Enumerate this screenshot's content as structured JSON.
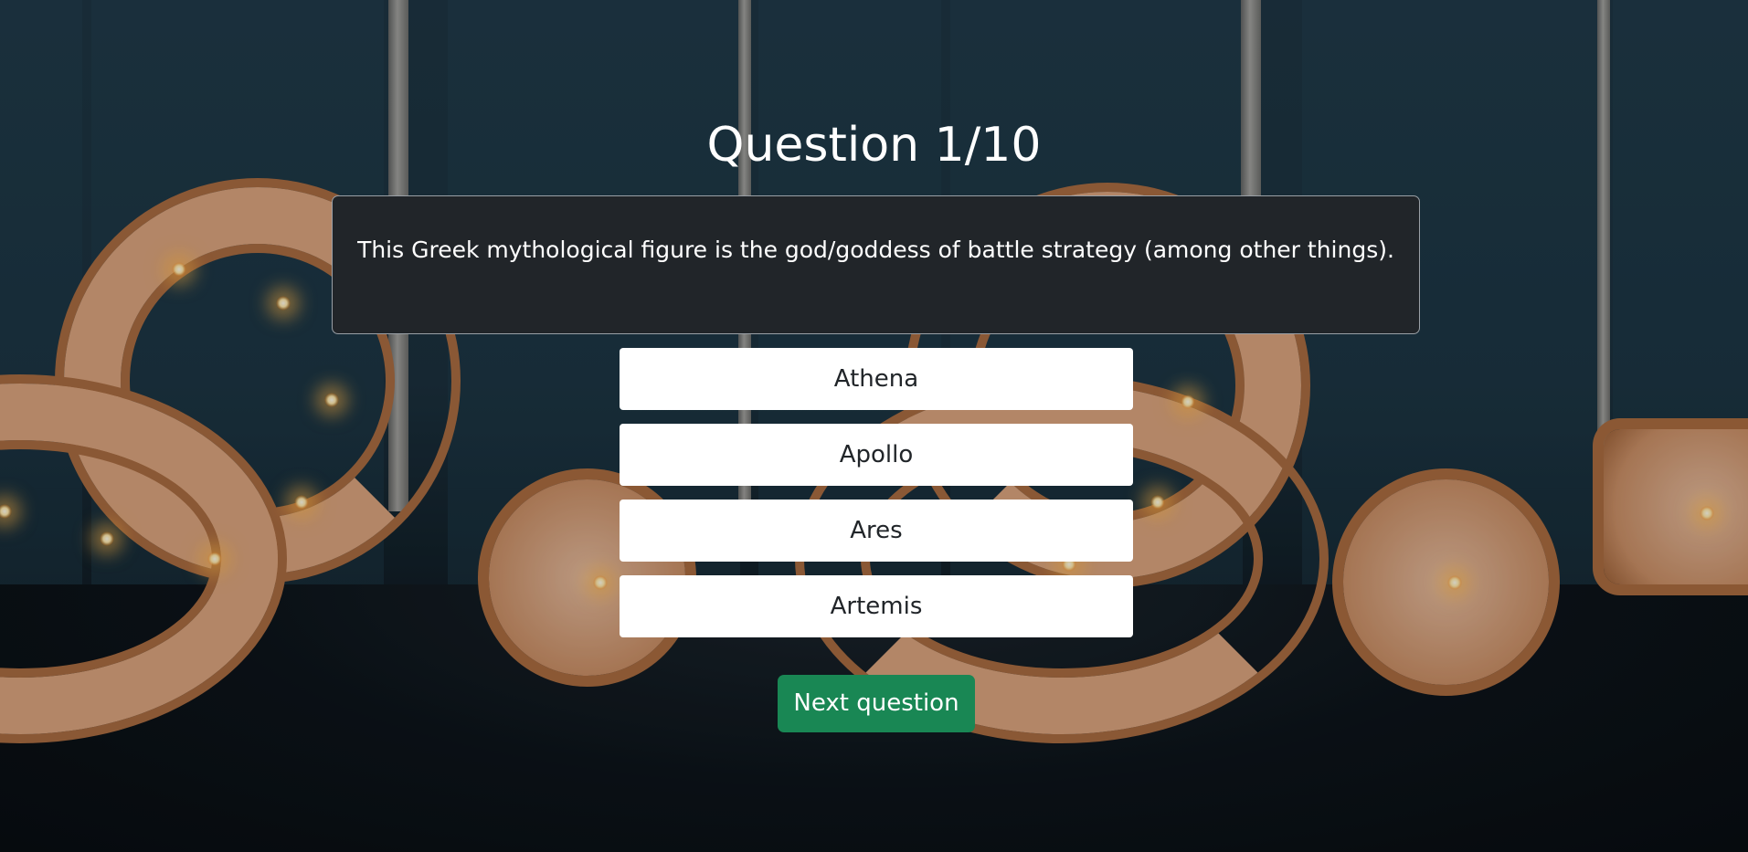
{
  "quiz": {
    "heading": "Question 1/10",
    "question_text": "This Greek mythological figure is the god/goddess of battle strategy (among other things).",
    "answers": [
      {
        "label": "Athena"
      },
      {
        "label": "Apollo"
      },
      {
        "label": "Ares"
      },
      {
        "label": "Artemis"
      }
    ],
    "next_label": "Next question"
  },
  "colors": {
    "card_background": "#212529",
    "answer_background": "#ffffff",
    "next_button": "#198754",
    "heading_text": "#ffffff"
  },
  "background": {
    "description_icon": "marquee-question-mark-lights-photo"
  }
}
